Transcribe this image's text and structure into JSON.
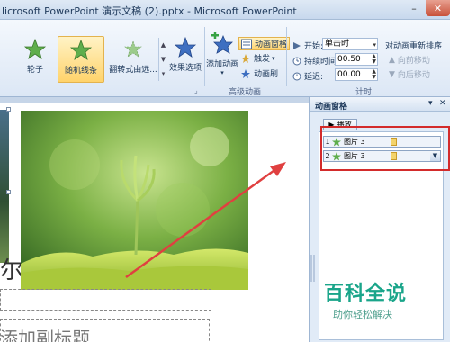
{
  "window": {
    "title": "licrosoft PowerPoint 演示文稿 (2).pptx - Microsoft PowerPoint",
    "minimize_icon": "minimize-icon",
    "close_icon": "close-icon"
  },
  "ribbon": {
    "effects": [
      {
        "label": "轮子",
        "icon": "star-wheel-icon",
        "selected": false
      },
      {
        "label": "随机线条",
        "icon": "star-random-lines-icon",
        "selected": true
      },
      {
        "label": "翻转式由远...",
        "icon": "star-flip-icon",
        "selected": false
      }
    ],
    "effect_options_label": "效果选项",
    "add_animation_label": "添加动画",
    "animation_pane_label": "动画窗格",
    "trigger_label": "触发",
    "animation_painter_label": "动画刷",
    "advanced_group_label": "高级动画",
    "start_label": "开始:",
    "start_value": "单击时",
    "duration_label": "持续时间:",
    "duration_value": "00.50",
    "delay_label": "延迟:",
    "delay_value": "00.00",
    "timing_group_label": "计时",
    "reorder_title": "对动画重新排序",
    "move_earlier_label": "向前移动",
    "move_later_label": "向后移动"
  },
  "slide": {
    "subtitle_placeholder": "添加副标题",
    "title_fragment": "尔"
  },
  "pane": {
    "title": "动画窗格",
    "play_label": "播放",
    "items": [
      {
        "index": "1",
        "name": "图片 3"
      },
      {
        "index": "2",
        "name": "图片 3"
      }
    ]
  },
  "watermark": {
    "main": "百科全说",
    "sub": "助你轻松解决"
  },
  "colors": {
    "highlight": "#d32b2b",
    "watermark": "#1aa58a",
    "ribbon_selected": "#ffd36b"
  }
}
